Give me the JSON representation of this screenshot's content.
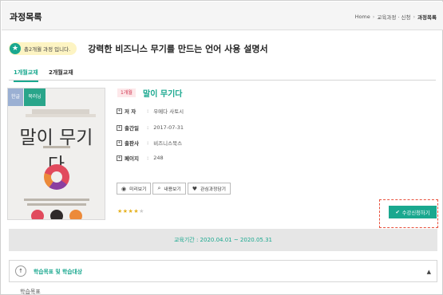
{
  "header": {
    "title": "과정목록",
    "breadcrumb": [
      "Home",
      "교육과정 · 신청",
      "과정목록"
    ]
  },
  "course": {
    "badge_text": "총2개월 과정 입니다.",
    "title": "강력한 비즈니스 무기를 만드는 언어 사용 설명서"
  },
  "tabs": [
    "1개월교재",
    "2개월교재"
  ],
  "book": {
    "tag_kr": "한글",
    "tag_bk": "북러닝",
    "cover_title": "말이 무기다",
    "level": "1개월",
    "title": "말이 무기다",
    "info": [
      {
        "label": "저   자",
        "value": "우메다 사토시"
      },
      {
        "label": "출간일",
        "value": "2017-07-31"
      },
      {
        "label": "출판사",
        "value": "비즈니스북스"
      },
      {
        "label": "페이지",
        "value": "248"
      }
    ],
    "buttons": [
      "미리보기",
      "내용보기",
      "관심과정담기"
    ],
    "rating": 4
  },
  "apply_label": "수강신청하기",
  "period": "교육기간 : 2020.04.01 ~ 2020.05.31",
  "accordion": {
    "label": "학습목표 및 학습대상"
  },
  "next_section_peek": "학습목표"
}
